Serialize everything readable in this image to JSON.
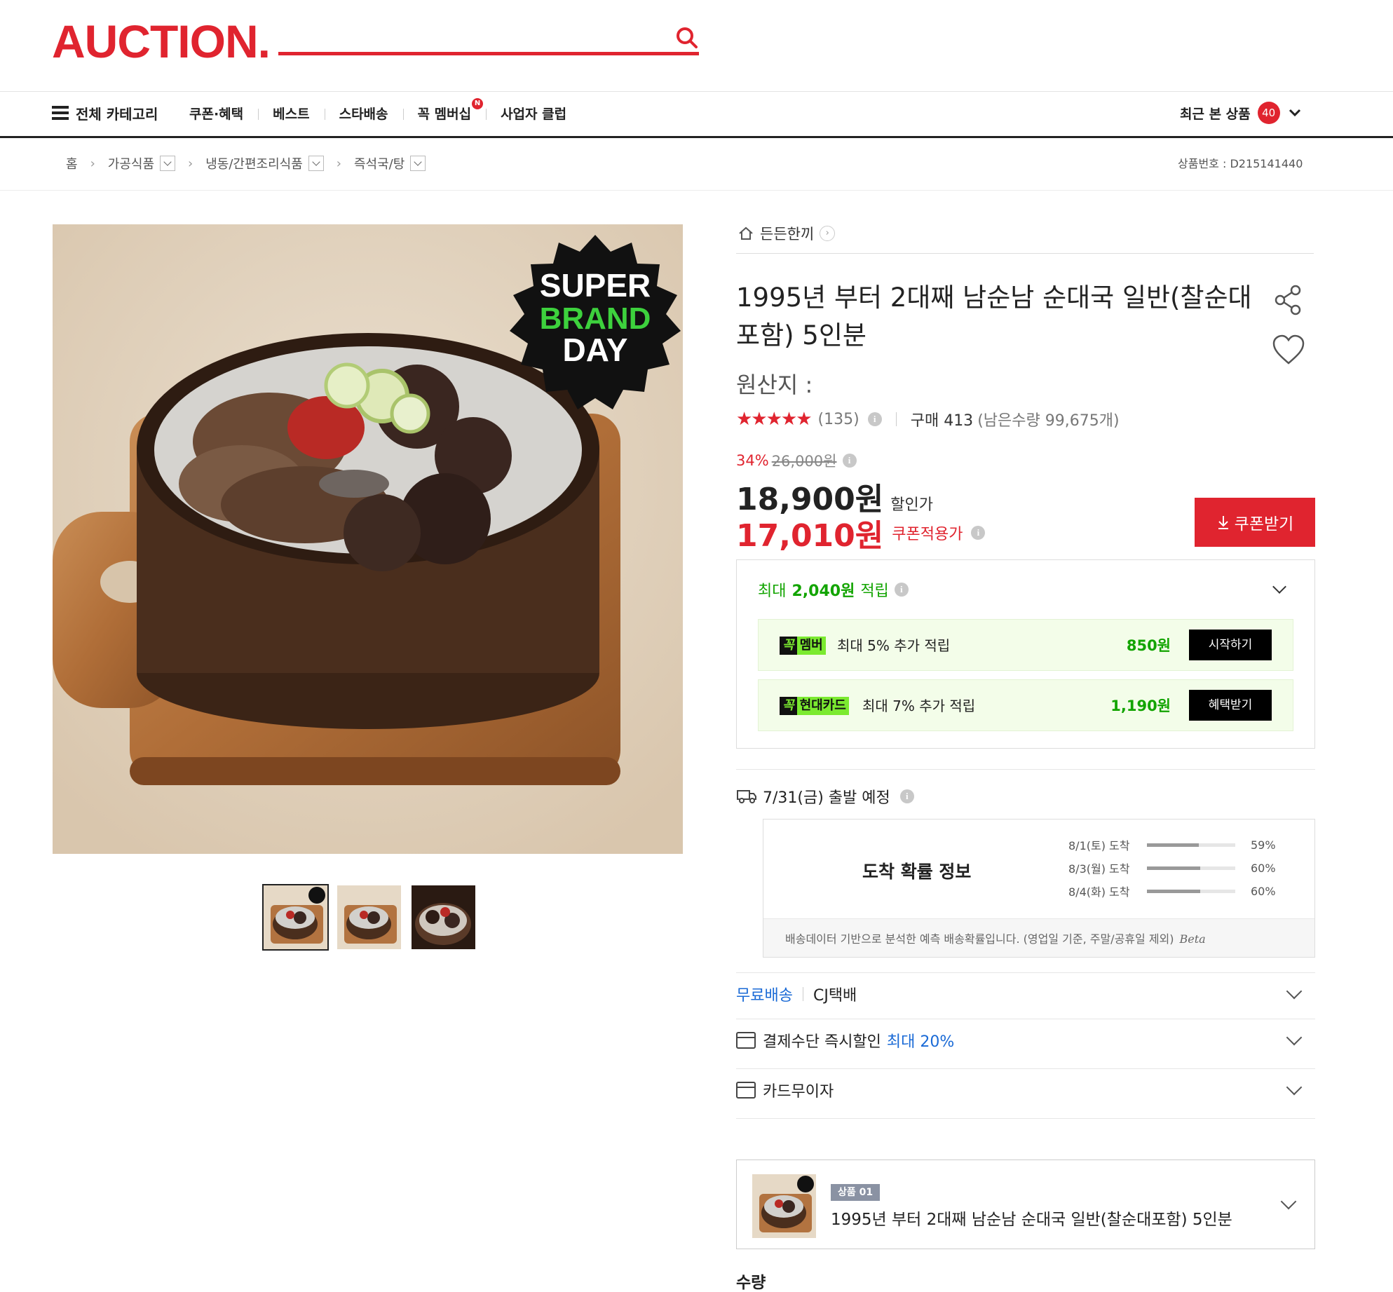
{
  "header": {
    "logo": "AUCTION.",
    "search_placeholder": "",
    "all_categories_label": "전체 카테고리",
    "nav": [
      {
        "label": "쿠폰·혜택"
      },
      {
        "label": "베스트"
      },
      {
        "label": "스타배송"
      },
      {
        "label": "꼭 멤버십",
        "badge": "N"
      },
      {
        "label": "사업자 클럽"
      }
    ],
    "recent_label": "최근 본 상품",
    "recent_count": "40"
  },
  "breadcrumb": {
    "home": "홈",
    "items": [
      "가공식품",
      "냉동/간편조리식품",
      "즉석국/탕"
    ],
    "product_number": "상품번호 : D215141440"
  },
  "product": {
    "store": "든든한끼",
    "title": "1995년 부터 2대째 남순남 순대국 일반(찰순대포함) 5인분",
    "origin": "원산지 :",
    "rating_stars": "★★★★★",
    "rating": 4.5,
    "review_count": "(135)",
    "purchase": "구매 413",
    "stock": "(남은수량 99,675개)",
    "discount_pct": "34%",
    "original_price": "26,000원",
    "sale_price": "18,900원",
    "sale_label": "할인가",
    "coupon_price": "17,010원",
    "coupon_label": "쿠폰적용가",
    "coupon_button": "쿠폰받기",
    "image_badge": {
      "line1": "SUPER",
      "line2": "BRAND",
      "line3": "DAY"
    }
  },
  "points": {
    "prefix": "최대",
    "amount": "2,040원",
    "suffix": "적립",
    "benefits": [
      {
        "tag1": "꼭",
        "tag2": "멤버",
        "text": "최대 5% 추가 적립",
        "amount": "850원",
        "button": "시작하기"
      },
      {
        "tag1": "꼭",
        "tag2": "현대카드",
        "text": "최대 7% 추가 적립",
        "amount": "1,190원",
        "button": "혜택받기"
      }
    ]
  },
  "shipping": {
    "departure": "7/31(금) 출발 예정",
    "arrival_title": "도착 확률 정보",
    "arrivals": [
      {
        "label": "8/1(토) 도착",
        "pct": "59%",
        "value": 0.59
      },
      {
        "label": "8/3(월) 도착",
        "pct": "60%",
        "value": 0.6
      },
      {
        "label": "8/4(화) 도착",
        "pct": "60%",
        "value": 0.6
      }
    ],
    "note": "배송데이터 기반으로 분석한 예측 배송확률입니다. (영업일 기준, 주말/공휴일 제외)",
    "beta": "Beta"
  },
  "options": {
    "free_shipping": "무료배송",
    "carrier": "CJ택배",
    "payment_discount": "결제수단 즉시할인",
    "payment_discount_highlight": "최대 20%",
    "installment": "카드무이자"
  },
  "option_select": {
    "badge": "상품 01",
    "name": "1995년 부터 2대째 남순남 순대국 일반(찰순대포함) 5인분"
  },
  "quantity_label": "수량",
  "colors": {
    "brand_red": "#e0242f",
    "points_green": "#12a400",
    "link_blue": "#1a6ad6"
  }
}
